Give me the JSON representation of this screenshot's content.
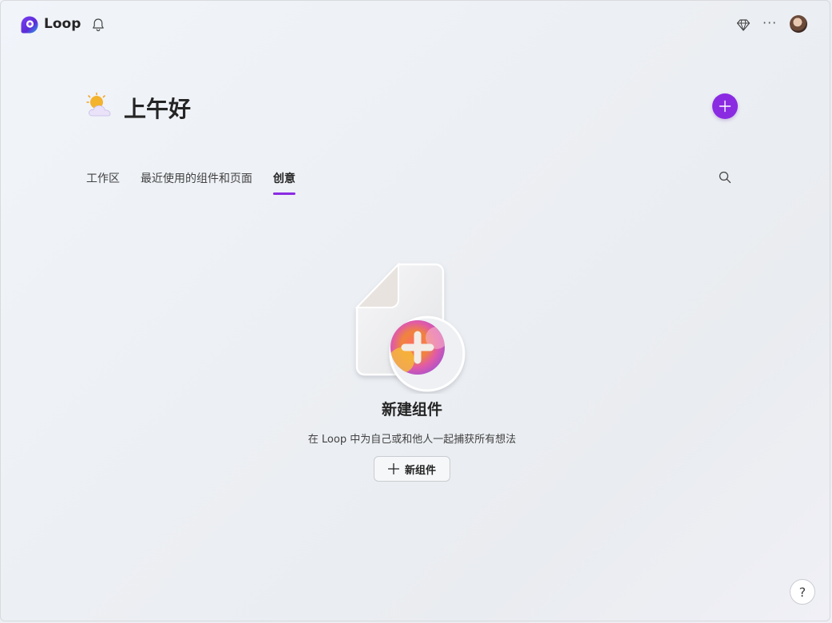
{
  "header": {
    "app_name": "Loop",
    "icons": [
      "loop-logo-icon",
      "bell-icon",
      "diamond-icon",
      "more-icon",
      "avatar"
    ],
    "more_glyph": "···"
  },
  "greeting": {
    "text": "上午好",
    "icon": "partly-cloudy-icon"
  },
  "tabs": [
    {
      "label": "工作区",
      "active": false
    },
    {
      "label": "最近使用的组件和页面",
      "active": false
    },
    {
      "label": "创意",
      "active": true
    }
  ],
  "empty_state": {
    "title": "新建组件",
    "description": "在 Loop 中为自己或和他人一起捕获所有想法",
    "button_label": "新组件"
  },
  "help": {
    "glyph": "?"
  },
  "colors": {
    "accent": "#8a2be2",
    "text": "#242424"
  }
}
